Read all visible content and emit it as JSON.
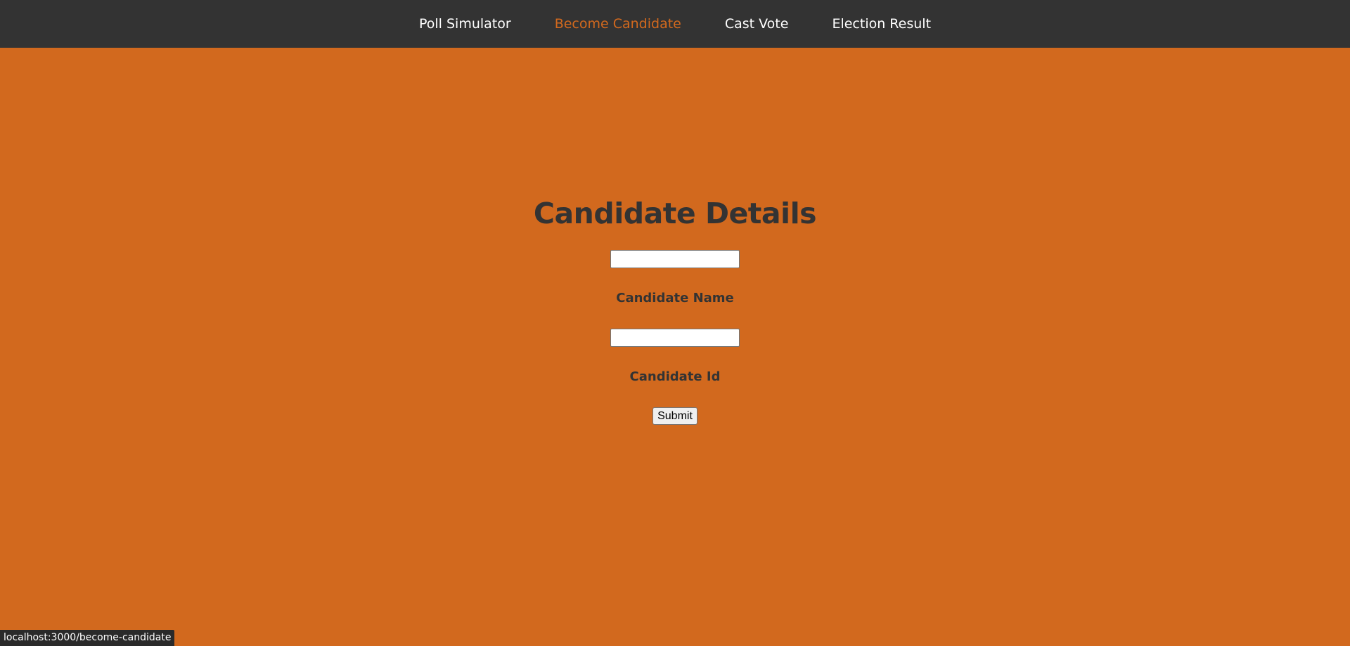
{
  "nav": {
    "items": [
      {
        "label": "Poll Simulator",
        "active": false
      },
      {
        "label": "Become Candidate",
        "active": true
      },
      {
        "label": "Cast Vote",
        "active": false
      },
      {
        "label": "Election Result",
        "active": false
      }
    ]
  },
  "form": {
    "title": "Candidate Details",
    "name_input_value": "",
    "name_label": "Candidate Name",
    "id_input_value": "",
    "id_label": "Candidate Id",
    "submit_label": "Submit"
  },
  "status_bar": {
    "url": "localhost:3000/become-candidate"
  },
  "colors": {
    "nav_background": "#333333",
    "page_background": "#d2691e",
    "active_link": "#d2691e",
    "text_dark": "#333333"
  }
}
